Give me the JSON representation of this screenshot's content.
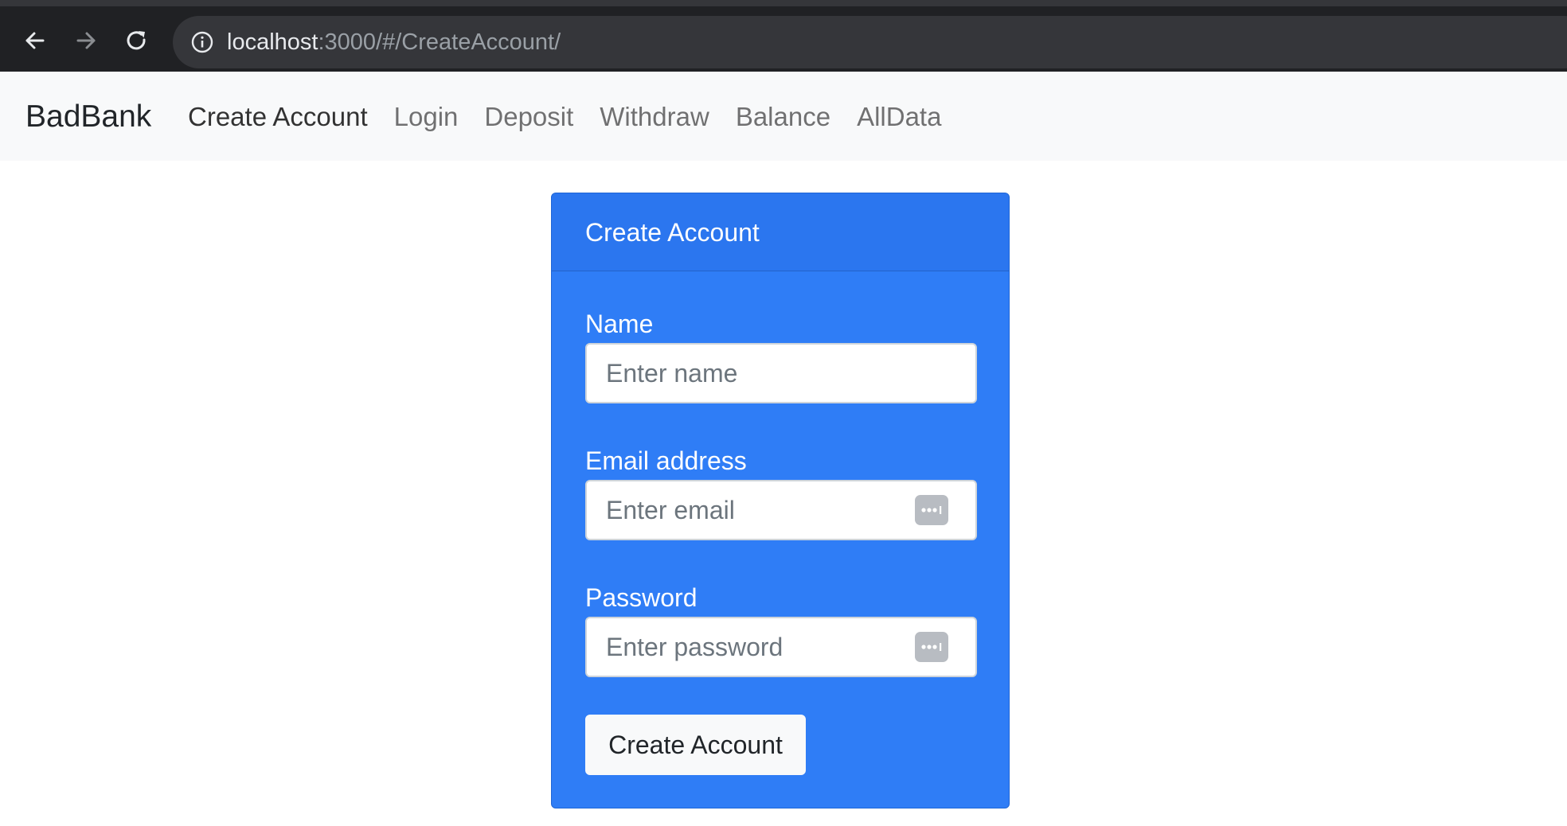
{
  "browser": {
    "url_host": "localhost",
    "url_path": ":3000/#/CreateAccount/"
  },
  "navbar": {
    "brand": "BadBank",
    "links": [
      {
        "label": "Create Account",
        "active": true
      },
      {
        "label": "Login",
        "active": false
      },
      {
        "label": "Deposit",
        "active": false
      },
      {
        "label": "Withdraw",
        "active": false
      },
      {
        "label": "Balance",
        "active": false
      },
      {
        "label": "AllData",
        "active": false
      }
    ]
  },
  "card": {
    "header": "Create Account",
    "fields": {
      "name": {
        "label": "Name",
        "placeholder": "Enter name",
        "value": ""
      },
      "email": {
        "label": "Email address",
        "placeholder": "Enter email",
        "value": ""
      },
      "password": {
        "label": "Password",
        "placeholder": "Enter password",
        "value": ""
      }
    },
    "submit_label": "Create Account"
  },
  "colors": {
    "card_background": "#2f7df6",
    "navbar_background": "#f8f9fa",
    "browser_background": "#202124"
  },
  "icons": [
    "back-arrow-icon",
    "forward-arrow-icon",
    "reload-icon",
    "info-icon",
    "password-manager-icon"
  ]
}
